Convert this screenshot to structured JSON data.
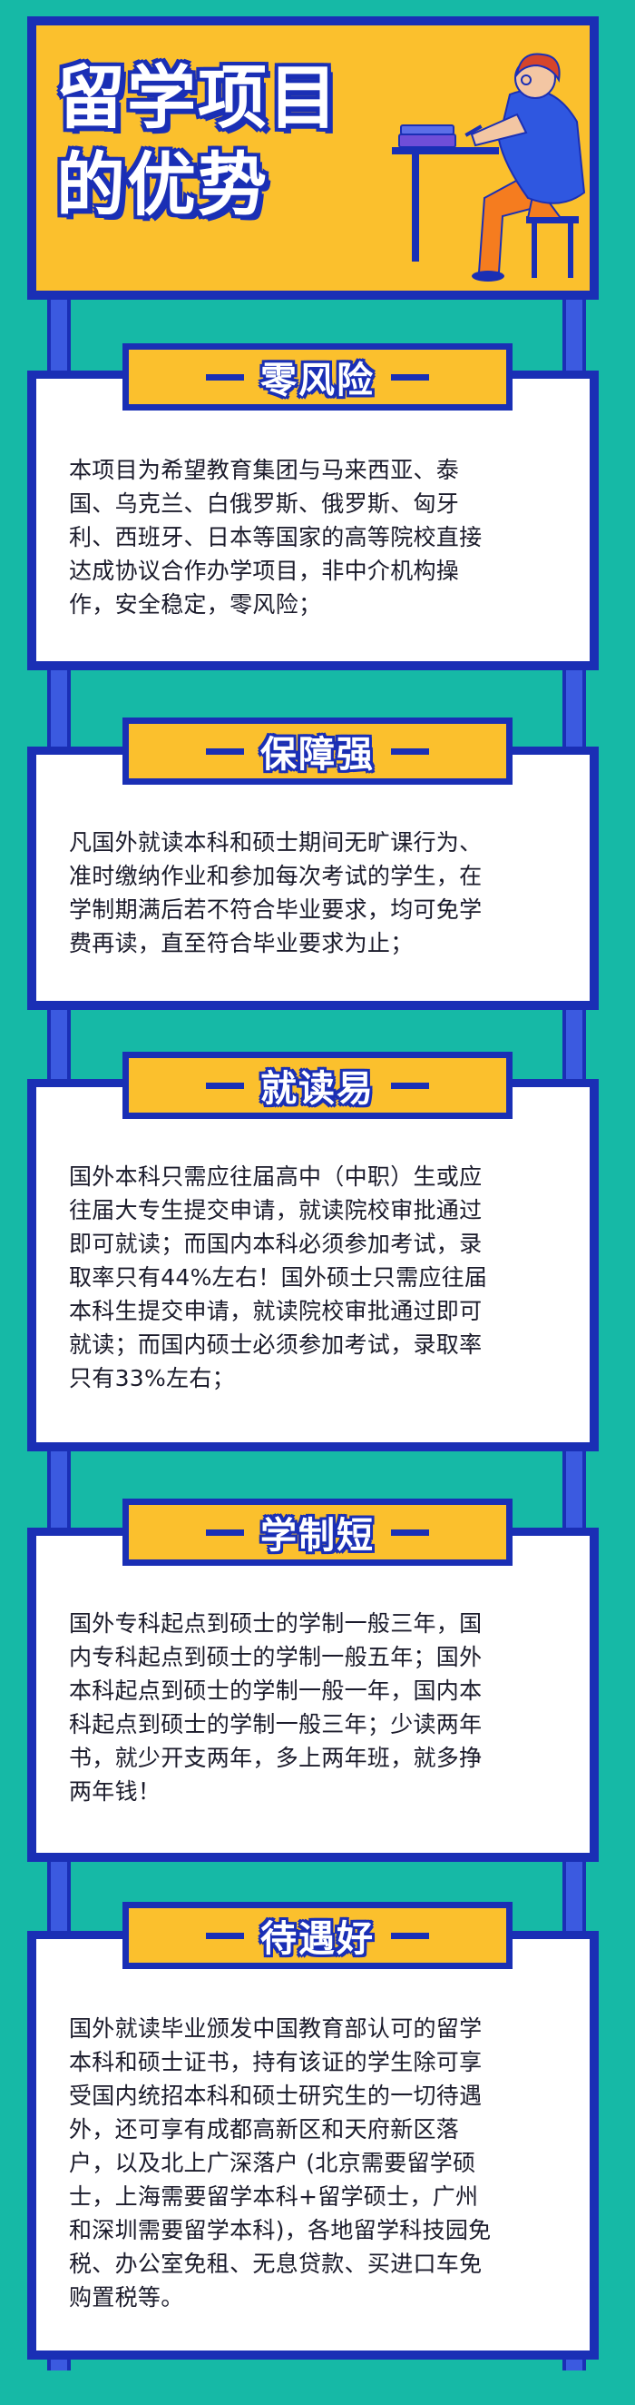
{
  "header": {
    "title_line1": "留学项目",
    "title_line2": "的优势"
  },
  "sections": [
    {
      "title": "零风险",
      "lines": [
        "本项目为希望教育集团与马来西亚、泰",
        "国、乌克兰、白俄罗斯、俄罗斯、匈牙",
        "利、西班牙、日本等国家的高等院校直接",
        "达成协议合作办学项目，非中介机构操",
        "作，安全稳定，零风险；"
      ]
    },
    {
      "title": "保障强",
      "lines": [
        "凡国外就读本科和硕士期间无旷课行为、",
        "准时缴纳作业和参加每次考试的学生，在",
        "学制期满后若不符合毕业要求，均可免学",
        "费再读，直至符合毕业要求为止；"
      ]
    },
    {
      "title": "就读易",
      "lines": [
        "国外本科只需应往届高中（中职）生或应",
        "往届大专生提交申请，就读院校审批通过",
        "即可就读；而国内本科必须参加考试，录",
        "取率只有44%左右！国外硕士只需应往届",
        "本科生提交申请，就读院校审批通过即可",
        "就读；而国内硕士必须参加考试，录取率",
        "只有33%左右；"
      ]
    },
    {
      "title": "学制短",
      "lines": [
        "国外专科起点到硕士的学制一般三年，国",
        "内专科起点到硕士的学制一般五年；国外",
        "本科起点到硕士的学制一般一年，国内本",
        "科起点到硕士的学制一般三年；少读两年",
        "书，就少开支两年，多上两年班，就多挣",
        "两年钱！"
      ]
    },
    {
      "title": "待遇好",
      "lines": [
        "国外就读毕业颁发中国教育部认可的留学",
        "本科和硕士证书，持有该证的学生除可享",
        "受国内统招本科和硕士研究生的一切待遇",
        "外，还可享有成都高新区和天府新区落",
        "户，以及北上广深落户 (北京需要留学硕",
        "士，上海需要留学本科+留学硕士，广州",
        "和深圳需要留学本科)，各地留学科技园免",
        "税、办公室免租、无息贷款、买进口车免",
        "购置税等。"
      ]
    }
  ],
  "colors": {
    "background": "#16b9a6",
    "navy": "#1a2fb5",
    "yellow": "#fbc02d",
    "card": "#ffffff",
    "text": "#1b1b2b"
  }
}
